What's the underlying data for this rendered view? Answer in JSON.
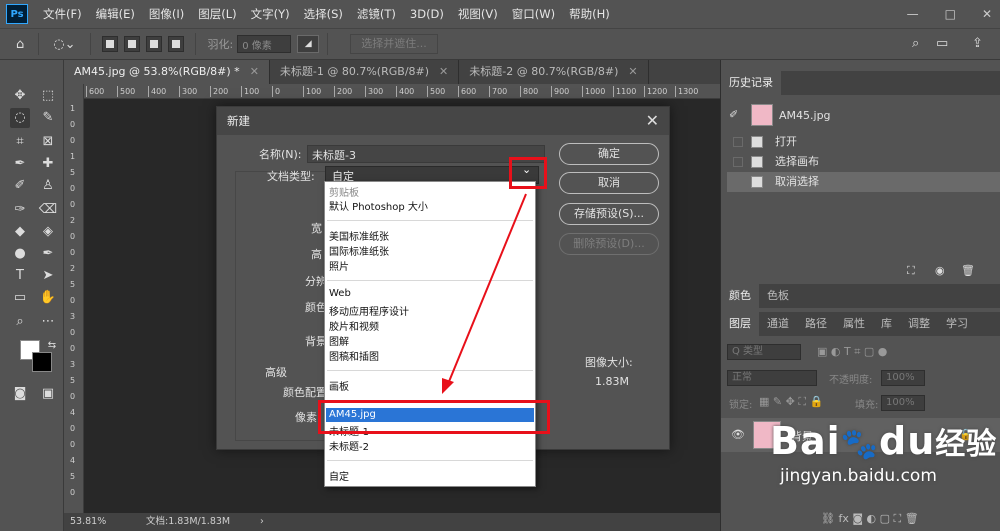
{
  "menubar": {
    "logo": "Ps",
    "items": [
      "文件(F)",
      "编辑(E)",
      "图像(I)",
      "图层(L)",
      "文字(Y)",
      "选择(S)",
      "滤镜(T)",
      "3D(D)",
      "视图(V)",
      "窗口(W)",
      "帮助(H)"
    ],
    "min": "—",
    "max": "□",
    "close": "✕"
  },
  "options": {
    "feather_label": "羽化:",
    "feather_value": "0 像素",
    "select_mask": "选择并遮住..."
  },
  "tabs": [
    {
      "label": "AM45.jpg @ 53.8%(RGB/8#) *",
      "close": "✕"
    },
    {
      "label": "未标题-1 @ 80.7%(RGB/8#)",
      "close": "✕"
    },
    {
      "label": "未标题-2 @ 80.7%(RGB/8#)",
      "close": "✕"
    }
  ],
  "ruler": {
    "h": [
      "600",
      "500",
      "400",
      "300",
      "200",
      "100",
      "0",
      "100",
      "200",
      "300",
      "400",
      "500",
      "600",
      "700",
      "800",
      "900",
      "1000",
      "1100",
      "1200",
      "1300"
    ],
    "v": [
      "1",
      "0",
      "0",
      "1",
      "5",
      "0",
      "0",
      "2",
      "0",
      "0",
      "2",
      "5",
      "0",
      "3",
      "0",
      "0",
      "3",
      "5",
      "0",
      "4",
      "0",
      "0",
      "4",
      "5",
      "0"
    ]
  },
  "status": {
    "zoom": "53.81%",
    "doc": "文档:1.83M/1.83M",
    "arrow": "›"
  },
  "dialog": {
    "title": "新建",
    "close": "✕",
    "name_label": "名称(N):",
    "name_value": "未标题-3",
    "doctype_label": "文档类型:",
    "doctype_value": "自定",
    "chevron": "⌄",
    "partial_labels": [
      "宽",
      "高",
      "分辨",
      "颜色",
      "背景"
    ],
    "advanced": "高级",
    "color_profile": "颜色配置",
    "pixel_aspect": "像素",
    "btn_ok": "确定",
    "btn_cancel": "取消",
    "btn_save": "存储预设(S)...",
    "btn_delete": "删除预设(D)...",
    "img_size_label": "图像大小:",
    "img_size_value": "1.83M"
  },
  "dropdown": {
    "items": [
      {
        "label": "剪贴板",
        "dim": true
      },
      {
        "label": "默认 Photoshop 大小"
      },
      {
        "label": "美国标准纸张"
      },
      {
        "label": "国际标准纸张"
      },
      {
        "label": "照片"
      },
      {
        "label": "Web"
      },
      {
        "label": "移动应用程序设计"
      },
      {
        "label": "胶片和视频"
      },
      {
        "label": "图解"
      },
      {
        "label": "图稿和插图"
      },
      {
        "label": "画板"
      },
      {
        "label": "AM45.jpg",
        "selected": true
      },
      {
        "label": "未标题-1"
      },
      {
        "label": "未标题-2"
      },
      {
        "label": "自定"
      }
    ]
  },
  "history": {
    "title": "历史记录",
    "snapshot": "AM45.jpg",
    "rows": [
      "打开",
      "选择画布",
      "取消选择"
    ]
  },
  "color_panel": {
    "tabs": [
      "颜色",
      "色板"
    ]
  },
  "layers": {
    "tabs": [
      "图层",
      "通道",
      "路径",
      "属性",
      "库",
      "调整",
      "学习"
    ],
    "kind": "Q 类型",
    "blend": "正常",
    "opacity_label": "不透明度:",
    "opacity": "100%",
    "lock_label": "锁定:",
    "fill_label": "填充:",
    "fill": "100%",
    "layer_name": "背景"
  },
  "watermark": {
    "brand": "Bai",
    "brand2": "du",
    "cn": "经验",
    "url": "jingyan.baidu.com"
  },
  "colors": {
    "highlight": "#2a75d6",
    "annotation_red": "#e8101a"
  }
}
